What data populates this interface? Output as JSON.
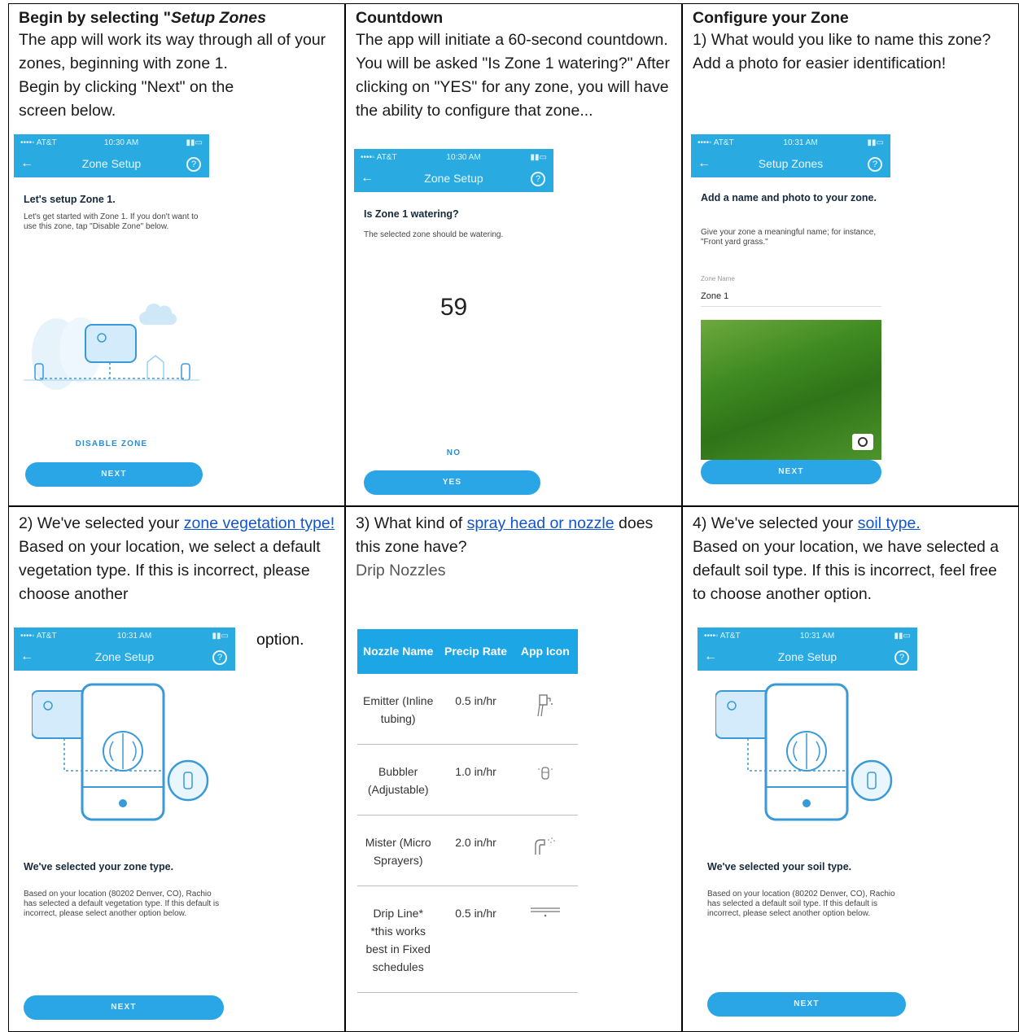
{
  "cells": {
    "c1": {
      "heading_prefix": "Begin by selecting \"",
      "heading_italic": "Setup Zones",
      "line1": "The app will work its way through all of your zones, beginning with zone 1.",
      "line2": "Begin by clicking \"Next\" on the screen below.",
      "screen": {
        "carrier": "••••◦ AT&T",
        "time": "10:30 AM",
        "bar_title": "Zone Setup",
        "title": "Let's setup Zone 1.",
        "body": "Let's get started with Zone 1. If you don't want to use this zone, tap \"Disable Zone\" below.",
        "link": "DISABLE ZONE",
        "button": "NEXT"
      }
    },
    "c2": {
      "heading": "Countdown",
      "body": "The app will initiate a 60-second countdown. You will be asked \"Is Zone 1 watering?\"  After clicking on \"YES\" for any zone, you will have the ability to configure that zone...",
      "screen": {
        "carrier": "••••◦ AT&T",
        "time": "10:30 AM",
        "bar_title": "Zone Setup",
        "title": "Is Zone 1 watering?",
        "body": "The selected zone should be watering.",
        "counter": "59",
        "link": "NO",
        "button": "YES"
      }
    },
    "c3": {
      "heading": "Configure your Zone",
      "body": "1) What would you like to name this zone? Add a photo for easier identification!",
      "screen": {
        "carrier": "••••◦ AT&T",
        "time": "10:31 AM",
        "bar_title": "Setup Zones",
        "title": "Add a name and photo to your zone.",
        "body": "Give your zone a meaningful name; for instance, \"Front yard grass.\"",
        "field_label": "Zone Name",
        "field_value": "Zone 1",
        "button": "NEXT"
      }
    },
    "c4": {
      "prefix": "2) We've selected your ",
      "link": "zone vegetation type!",
      "body": "Based on your location, we select a default vegetation type. If this is incorrect, please choose another",
      "tail": "option.",
      "screen": {
        "carrier": "••••◦ AT&T",
        "time": "10:31 AM",
        "bar_title": "Zone Setup",
        "title": "We've selected your zone type.",
        "body": "Based on your location (80202 Denver, CO), Rachio has selected a default vegetation type. If this default is incorrect, please select another option below.",
        "button": "NEXT"
      }
    },
    "c5": {
      "prefix": "3) What kind of ",
      "link": "spray head or nozzle",
      "suffix": " does this zone have?",
      "subtitle": "Drip Nozzles",
      "table": {
        "headers": [
          "Nozzle Name",
          "Precip Rate",
          "App Icon"
        ],
        "rows": [
          {
            "name": "Emitter (Inline tubing)",
            "rate": "0.5 in/hr",
            "icon": "emitter-icon"
          },
          {
            "name": "Bubbler (Adjustable)",
            "rate": "1.0 in/hr",
            "icon": "bubbler-icon"
          },
          {
            "name": "Mister (Micro Sprayers)",
            "rate": "2.0 in/hr",
            "icon": "mister-icon"
          },
          {
            "name": "Drip Line* *this works best in Fixed schedules",
            "rate": "0.5 in/hr",
            "icon": "drip-line-icon"
          }
        ]
      }
    },
    "c6": {
      "prefix": "4) We've selected your ",
      "link": "soil type.",
      "body": "Based on your location, we have selected a default soil type. If this is incorrect, feel free to choose another option.",
      "screen": {
        "carrier": "••••◦ AT&T",
        "time": "10:31 AM",
        "bar_title": "Zone Setup",
        "title": "We've selected your soil type.",
        "body": "Based on your location (80202 Denver, CO), Rachio has selected a default soil type. If this default is incorrect, please select another option below.",
        "button": "NEXT"
      }
    }
  },
  "colors": {
    "accent": "#29abe2",
    "link": "#1155cc",
    "table_header": "#1ca6e6"
  }
}
